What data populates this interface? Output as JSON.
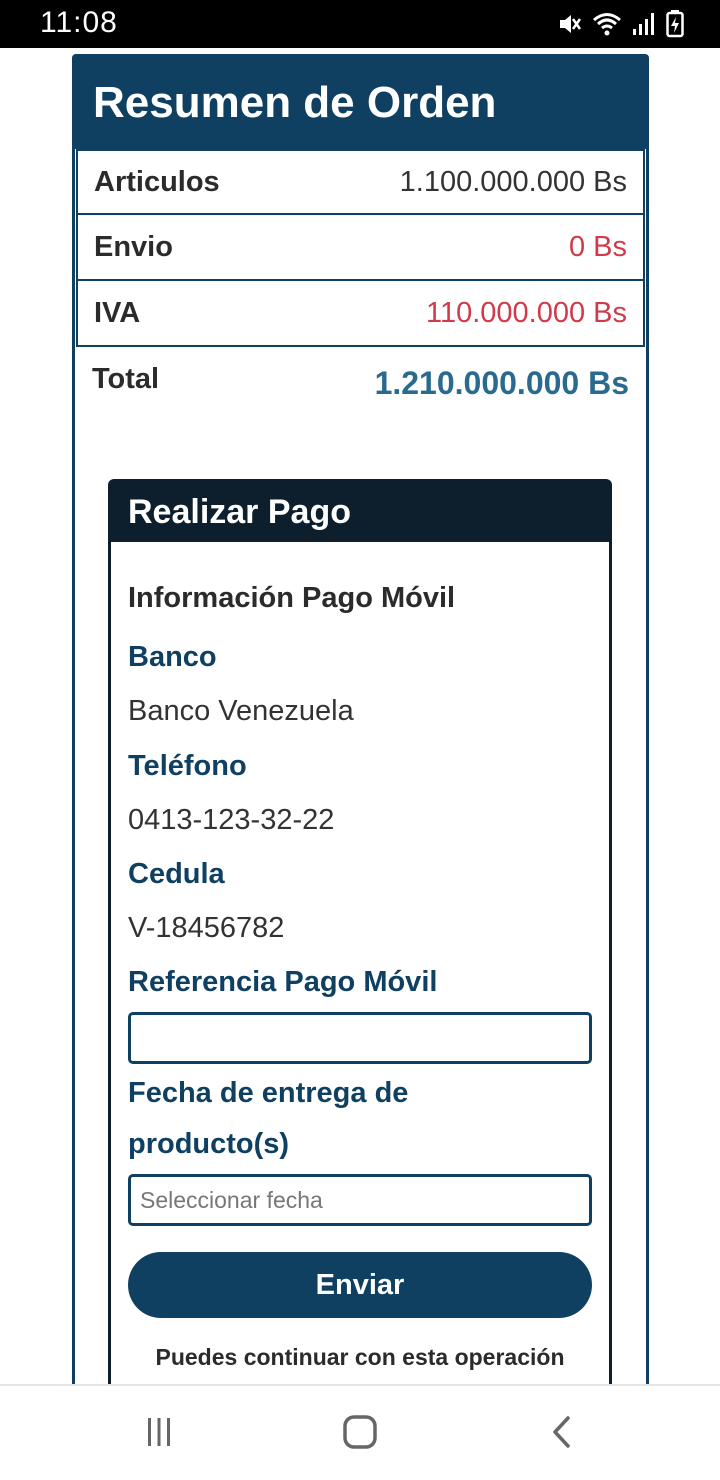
{
  "status_bar": {
    "time": "11:08",
    "icons": [
      "mute-icon",
      "wifi-icon",
      "signal-icon",
      "battery-icon"
    ]
  },
  "order_summary": {
    "title": "Resumen de Orden",
    "rows": [
      {
        "label": "Articulos",
        "value": "1.100.000.000 Bs"
      },
      {
        "label": "Envio",
        "value": "0 Bs"
      },
      {
        "label": "IVA",
        "value": "110.000.000 Bs"
      }
    ],
    "total": {
      "label": "Total",
      "value": "1.210.000.000 Bs"
    }
  },
  "payment": {
    "title": "Realizar Pago",
    "info_title": "Información Pago Móvil",
    "bank_label": "Banco",
    "bank_value": "Banco Venezuela",
    "phone_label": "Teléfono",
    "phone_value": "0413-123-32-22",
    "id_label": "Cedula",
    "id_value": "V-18456782",
    "reference_label": "Referencia Pago Móvil",
    "reference_value": "",
    "date_label_line1": "Fecha de entrega de",
    "date_label_line2": "producto(s)",
    "date_placeholder": "Seleccionar fecha",
    "submit_label": "Enviar",
    "note": "Puedes continuar con esta operación"
  },
  "colors": {
    "primary": "#0f4061",
    "dark_header": "#0d1f2d",
    "red_value": "#d03a4a",
    "total_value": "#2a6a8e"
  },
  "nav_bar": {
    "icons": [
      "recent-apps-icon",
      "home-icon",
      "back-icon"
    ]
  }
}
